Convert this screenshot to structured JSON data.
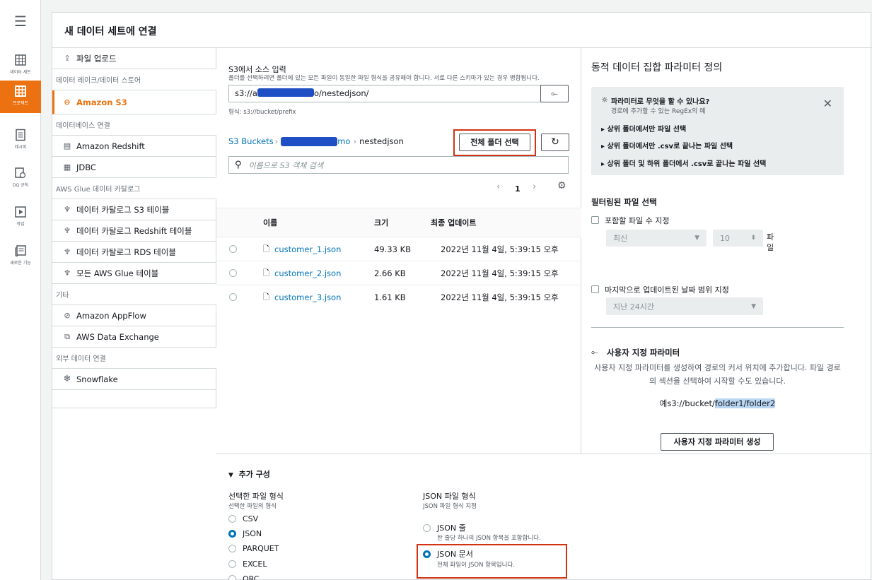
{
  "rail": {
    "items": [
      {
        "label": "데이터 세트"
      },
      {
        "label": "프로젝트"
      },
      {
        "label": "레시피"
      },
      {
        "label": "DQ 규칙"
      },
      {
        "label": "작업"
      },
      {
        "label": "새로운 기능"
      }
    ]
  },
  "page": {
    "title": "새 데이터 세트에 연결"
  },
  "sources": {
    "upload": "파일 업로드",
    "sec_lake": "데이터 레이크/데이터 스토어",
    "s3": "Amazon S3",
    "sec_db": "데이터베이스 연결",
    "redshift": "Amazon Redshift",
    "jdbc": "JDBC",
    "sec_glue": "AWS Glue 데이터 카탈로그",
    "glue_s3": "데이터 카탈로그 S3 테이블",
    "glue_redshift": "데이터 카탈로그 Redshift 테이블",
    "glue_rds": "데이터 카탈로그 RDS 테이블",
    "glue_all": "모든 AWS Glue 테이블",
    "sec_other": "기타",
    "appflow": "Amazon AppFlow",
    "dataexchange": "AWS Data Exchange",
    "sec_external": "외부 데이터 연결",
    "snowflake": "Snowflake"
  },
  "s3": {
    "label": "S3에서 소스 입력",
    "hint": "폴더를 선택하려면 폴더에 있는 모든 파일이 동일한 파일 형식을 공유해야 합니다. 서로 다른 스키마가 있는 경우 병합됩니다.",
    "value_prefix": "s3://a",
    "value_suffix": "o/nestedjson/",
    "format_hint": "형식: s3://bucket/prefix",
    "breadcrumb_root": "S3 Buckets",
    "breadcrumb_bucket_suffix": "mo",
    "breadcrumb_folder": "nestedjson",
    "select_all_button": "전체 폴더 선택",
    "search_placeholder": "이름으로 S3 객체 검색",
    "page": "1",
    "columns": {
      "name": "이름",
      "size": "크기",
      "updated": "최종 업데이트"
    },
    "rows": [
      {
        "name": "customer_1.json",
        "size": "49.33 KB",
        "updated": "2022년 11월 4일, 5:39:15 오후"
      },
      {
        "name": "customer_2.json",
        "size": "2.66 KB",
        "updated": "2022년 11월 4일, 5:39:15 오후"
      },
      {
        "name": "customer_3.json",
        "size": "1.61 KB",
        "updated": "2022년 11월 4일, 5:39:15 오후"
      }
    ]
  },
  "params": {
    "title": "동적 데이터 집합 파라미터 정의",
    "info_title": "파라미터로 무엇을 할 수 있나요?",
    "info_sub": "경로에 추가할 수 있는 RegEx의 예",
    "info_items": [
      "상위 폴더에서만 파일 선택",
      "상위 폴더에서만 .csv로 끝나는 파일 선택",
      "상위 폴더 및 하위 폴더에서 .csv로 끝나는 파일 선택"
    ],
    "filtered_title": "필터링된 파일 선택",
    "count_label": "포함할 파일 수 지정",
    "sort_value": "최신",
    "count_value": "10",
    "count_unit": "파일",
    "date_label": "마지막으로 업데이트된 날짜 범위 지정",
    "date_value": "지난 24시간",
    "custom_title": "사용자 지정 파라미터",
    "custom_desc": "사용자 지정 파라미터를 생성하여 경로의 커서 위치에 추가합니다. 파일 경로의 섹션을 선택하여 시작할 수도 있습니다.",
    "example_prefix": "예s3://bucket/",
    "example_highlight": "folder1/folder2",
    "create_button": "사용자 지정 파라미터 생성"
  },
  "config": {
    "title": "추가 구성",
    "file_type_label": "선택한 파일 형식",
    "file_type_hint": "선택한 파일의 형식",
    "file_types": [
      "CSV",
      "JSON",
      "PARQUET",
      "EXCEL",
      "ORC"
    ],
    "selected_file_type": "JSON",
    "json_label": "JSON 파일 형식",
    "json_hint": "JSON 파일 형식 지정",
    "json_lines": "JSON 줄",
    "json_lines_desc": "한 줄당 하나의 JSON 항목을 포함합니다.",
    "json_doc": "JSON 문서",
    "json_doc_desc": "전체 파일이 JSON 항목입니다.",
    "selected_json": "JSON 문서"
  },
  "colors": {
    "accent": "#ec7211",
    "link": "#0073bb",
    "highlight_box": "#d13212",
    "redaction": "#1f4fc4"
  }
}
